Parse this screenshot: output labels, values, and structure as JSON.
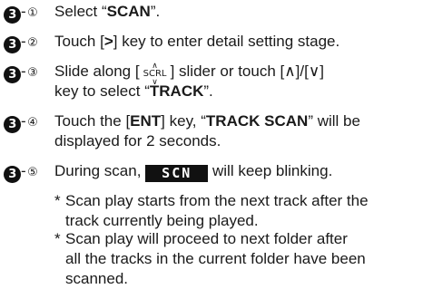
{
  "steps": [
    {
      "num": "3",
      "sub": "①",
      "text_pre": "Select “",
      "bold": "SCAN",
      "text_post": "”."
    },
    {
      "num": "3",
      "sub": "②",
      "text_pre": "Touch [",
      "bold": ">",
      "text_post": "] key to enter detail setting stage."
    },
    {
      "num": "3",
      "sub": "③",
      "text_pre": "Slide along [",
      "scrl": "SCRL",
      "text_mid": "] slider or touch [∧]/[∨]",
      "line2_pre": "key to select “",
      "bold": "TRACK",
      "line2_post": "”."
    },
    {
      "num": "3",
      "sub": "④",
      "text_pre": "Touch the [",
      "bold": "ENT",
      "text_mid": "] key, “",
      "bold2": "TRACK SCAN",
      "text_post": "” will be",
      "line2": "displayed for 2 seconds."
    },
    {
      "num": "3",
      "sub": "⑤",
      "text_pre": "During scan,",
      "badge": "SCN",
      "text_post": "will keep blinking."
    }
  ],
  "notes": [
    {
      "lines": [
        "Scan play starts from the next track after the",
        "track currently being played."
      ]
    },
    {
      "lines": [
        "Scan play will proceed to next folder after",
        "all the tracks in the current folder have been",
        "scanned."
      ]
    }
  ]
}
